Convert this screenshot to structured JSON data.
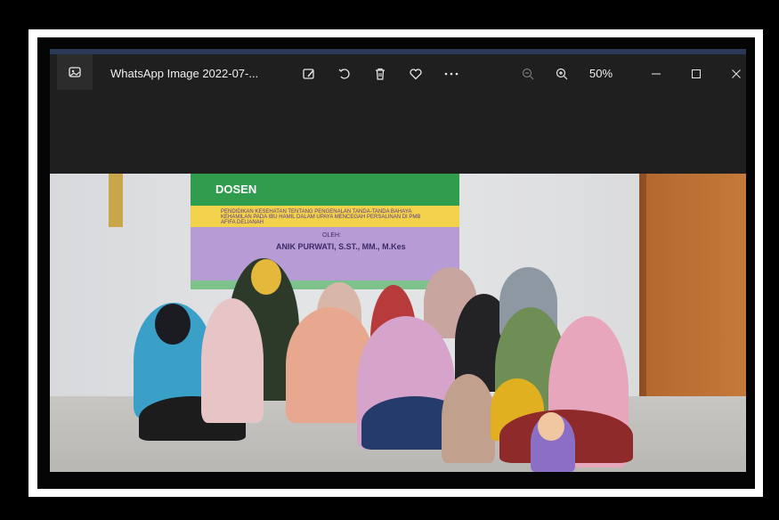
{
  "window": {
    "title": "WhatsApp Image 2022-07-...",
    "zoom": "50%"
  },
  "icons": {
    "app": "photos-app-icon",
    "edit": "edit-image-icon",
    "rotate": "rotate-icon",
    "delete": "trash-icon",
    "favorite": "heart-icon",
    "more": "more-icon",
    "zoom_out": "zoom-out-icon",
    "zoom_in": "zoom-in-icon",
    "minimize": "minimize-icon",
    "maximize": "maximize-icon",
    "close": "close-icon"
  },
  "photo": {
    "banner_title": "DOSEN",
    "banner_subtitle": "PENDIDIKAN KESEHATAN TENTANG PENGENALAN TANDA-TANDA BAHAYA KEHAMILAN PADA IBU HAMIL DALAM UPAYA MENCEGAH PERSALINAN DI PMB AFIFA DELIANAH",
    "banner_oleh": "OLEH:",
    "banner_name": "ANIK PURWATI, S.ST., MM., M.Kes"
  },
  "colors": {
    "titlebar_bg": "#1f1f1f",
    "accent_line": "#2a3a56"
  }
}
